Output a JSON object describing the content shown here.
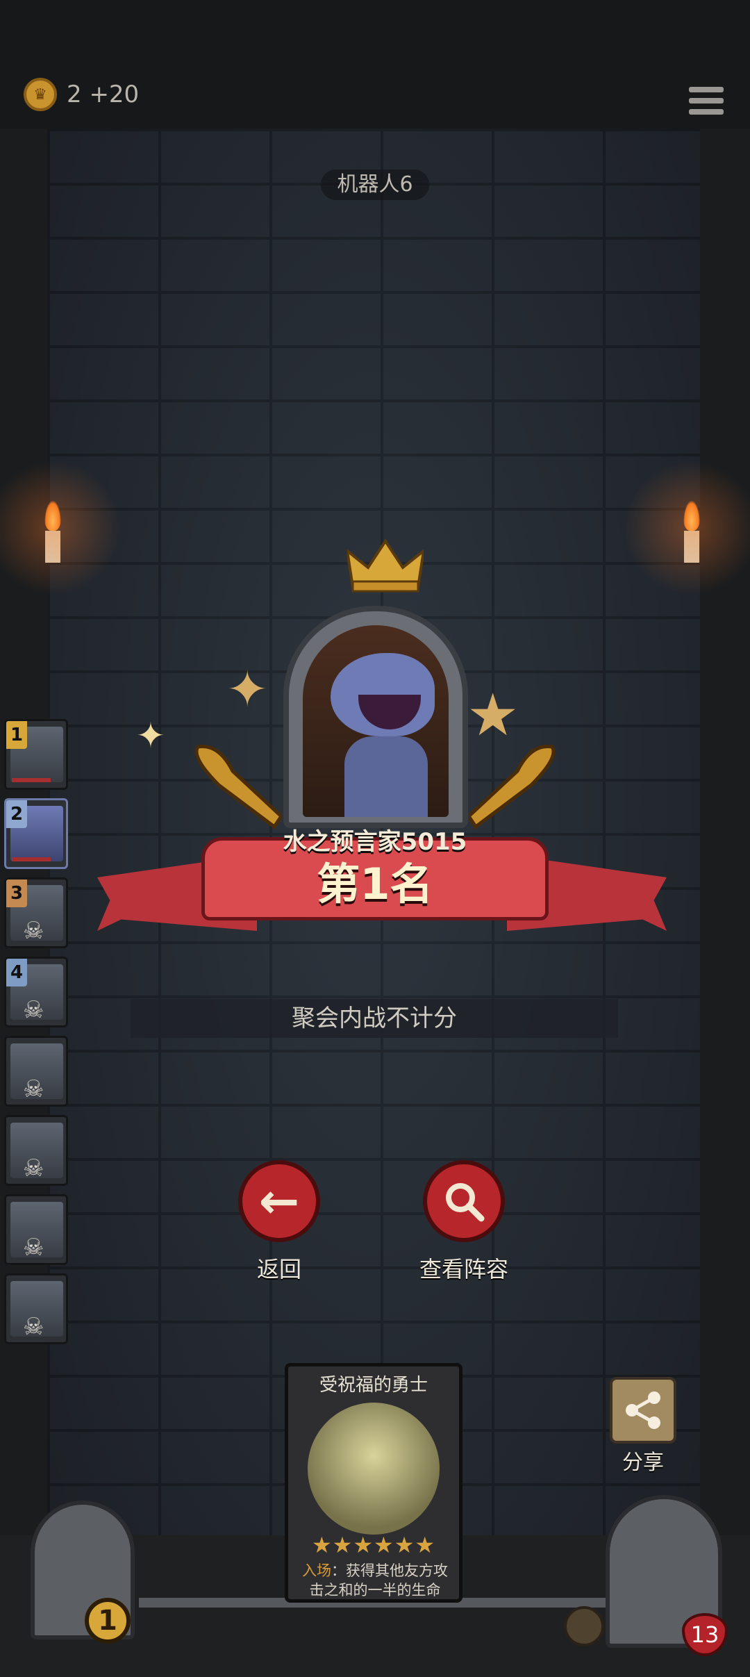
{
  "header": {
    "coin_icon": "crown-coin-icon",
    "coin_value": "2 +20",
    "menu_icon": "hamburger-menu-icon"
  },
  "room": {
    "name": "机器人6"
  },
  "ranking": {
    "entries": [
      {
        "rank": "1",
        "badge_color": "#d8a73a",
        "eliminated": false
      },
      {
        "rank": "2",
        "badge_color": "#8ea8cf",
        "eliminated": false
      },
      {
        "rank": "3",
        "badge_color": "#c48a52",
        "eliminated": true
      },
      {
        "rank": "4",
        "badge_color": "#7f9cc4",
        "eliminated": true
      },
      {
        "rank": "",
        "badge_color": "",
        "eliminated": true
      },
      {
        "rank": "",
        "badge_color": "",
        "eliminated": true
      },
      {
        "rank": "",
        "badge_color": "",
        "eliminated": true
      },
      {
        "rank": "",
        "badge_color": "",
        "eliminated": true
      }
    ]
  },
  "result": {
    "player_name": "水之预言家5015",
    "placement": "第1名",
    "notice": "聚会内战不计分"
  },
  "actions": {
    "back_label": "返回",
    "back_icon": "arrow-left-icon",
    "view_lineup_label": "查看阵容",
    "view_lineup_icon": "magnifier-icon"
  },
  "card": {
    "title": "受祝福的勇士",
    "stars": "★★★★★★",
    "star_count": 6,
    "keyword": "入场",
    "description": "：获得其他友方攻击之和的一半的生命"
  },
  "share": {
    "label": "分享",
    "icon": "share-icon"
  },
  "hero": {
    "level": "1",
    "health": "13"
  },
  "colors": {
    "banner_red": "#d94b4f",
    "button_red": "#b6262a",
    "gold": "#d8a73a"
  }
}
